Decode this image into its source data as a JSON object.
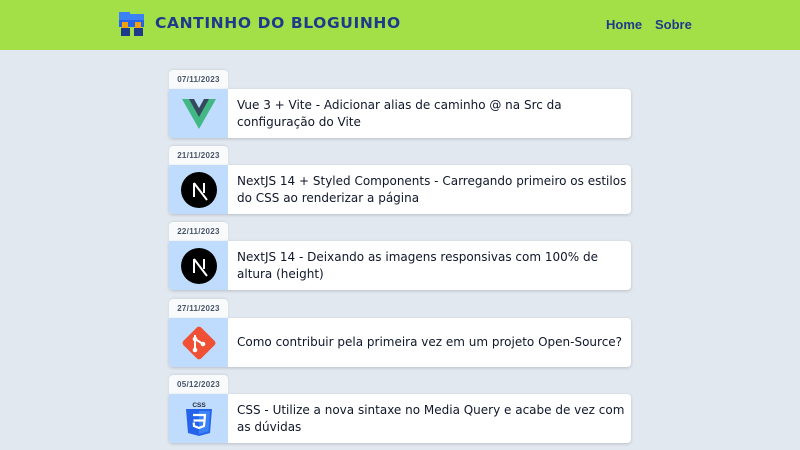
{
  "header": {
    "logo_text": "Cantinho do Bloguinho",
    "nav": {
      "home": "Home",
      "sobre": "Sobre"
    }
  },
  "colors": {
    "header_bg": "#a3e048",
    "page_bg": "#e2e8f0",
    "brand_text": "#1e3a8a",
    "thumb_bg": "#bfdbfe"
  },
  "posts": [
    {
      "date": "07/11/2023",
      "title": "Vue 3 + Vite - Adicionar alias de caminho @ na Src da configuração do Vite",
      "icon": "vue-icon"
    },
    {
      "date": "21/11/2023",
      "title": "NextJS 14 + Styled Components - Carregando primeiro os estilos do CSS ao renderizar a página",
      "icon": "nextjs-icon"
    },
    {
      "date": "22/11/2023",
      "title": "NextJS 14 - Deixando as imagens responsivas com 100% de altura (height)",
      "icon": "nextjs-icon"
    },
    {
      "date": "27/11/2023",
      "title": "Como contribuir pela primeira vez em um projeto Open-Source?",
      "icon": "git-icon"
    },
    {
      "date": "05/12/2023",
      "title": "CSS - Utilize a nova sintaxe no Media Query e acabe de vez com as dúvidas",
      "icon": "css3-icon",
      "icon_label": "CSS"
    }
  ]
}
